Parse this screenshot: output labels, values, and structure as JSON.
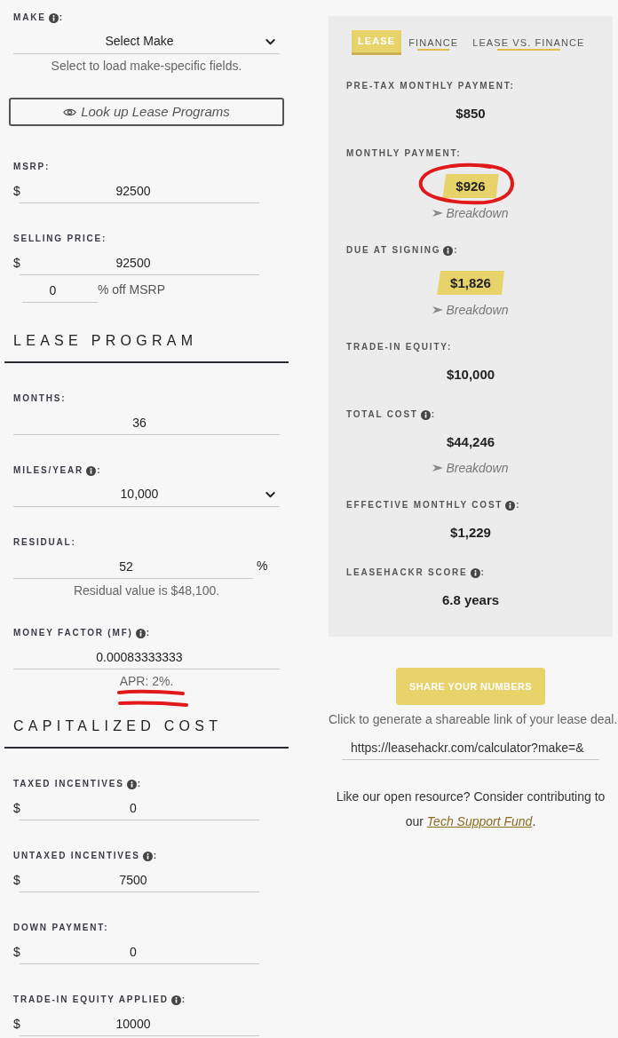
{
  "sections": [
    {
      "fields": [
        {
          "kind": "select",
          "label": "MAKE",
          "info": true,
          "suffix": ":",
          "value": "Select Make",
          "note": {
            "text": "Select to load make-specific fields.",
            "underlined": false
          }
        },
        {
          "kind": "button",
          "label": "Look up Lease Programs"
        },
        {
          "kind": "currency",
          "label": "MSRP:",
          "info": false,
          "currency": "$",
          "value": "92500"
        },
        {
          "kind": "currency",
          "label": "SELLING PRICE:",
          "info": false,
          "currency": "$",
          "value": "92500",
          "discount": {
            "value": "0",
            "label": "% off MSRP"
          }
        }
      ]
    },
    {
      "heading": "LEASE PROGRAM",
      "fields": [
        {
          "kind": "number",
          "label": "MONTHS:",
          "info": false,
          "value": "36"
        },
        {
          "kind": "select",
          "label": "MILES/YEAR",
          "info": true,
          "suffix": ":",
          "value": "10,000"
        },
        {
          "kind": "percent",
          "label": "RESIDUAL:",
          "info": false,
          "value": "52",
          "unit": "%",
          "note": {
            "text": "Residual value is $48,100.",
            "underlined": false
          }
        },
        {
          "kind": "number",
          "label": "MONEY FACTOR (MF)",
          "info": true,
          "suffix": ":",
          "value": "0.00083333333",
          "note": {
            "text": "APR: 2%.",
            "underlined": true
          }
        }
      ]
    },
    {
      "heading": "CAPITALIZED COST",
      "fields": [
        {
          "kind": "currency",
          "label": "TAXED INCENTIVES",
          "info": true,
          "suffix": ":",
          "currency": "$",
          "value": "0"
        },
        {
          "kind": "currency",
          "label": "UNTAXED INCENTIVES",
          "info": true,
          "suffix": ":",
          "currency": "$",
          "value": "7500"
        },
        {
          "kind": "currency",
          "label": "DOWN PAYMENT:",
          "info": false,
          "currency": "$",
          "value": "0"
        },
        {
          "kind": "currency",
          "label": "TRADE-IN EQUITY APPLIED",
          "info": true,
          "suffix": ":",
          "currency": "$",
          "value": "10000"
        }
      ]
    }
  ],
  "tabs": [
    {
      "label": "LEASE",
      "selected": true
    },
    {
      "label": "FINANCE",
      "selected": false
    },
    {
      "label": "LEASE VS. FINANCE",
      "selected": false
    }
  ],
  "results": [
    {
      "label": "PRE-TAX MONTHLY PAYMENT:",
      "info": false,
      "kind": "plain",
      "value": "$850",
      "circled": false
    },
    {
      "label": "MONTHLY PAYMENT:",
      "info": false,
      "kind": "tag",
      "value": "$926",
      "breakdown": "Breakdown",
      "circled": true
    },
    {
      "label": "DUE AT SIGNING",
      "info": true,
      "suffix": ":",
      "kind": "tag",
      "value": "$1,826",
      "breakdown": "Breakdown",
      "circled": false
    },
    {
      "label": "TRADE-IN EQUITY:",
      "info": false,
      "kind": "plain",
      "value": "$10,000",
      "circled": false
    },
    {
      "label": "TOTAL COST",
      "info": true,
      "suffix": ":",
      "kind": "plain",
      "value": "$44,246",
      "breakdown": "Breakdown",
      "circled": false
    },
    {
      "label": "EFFECTIVE MONTHLY COST",
      "info": true,
      "suffix": ":",
      "kind": "plain",
      "value": "$1,229",
      "circled": false
    },
    {
      "label": "LEASEHACKR SCORE",
      "info": true,
      "suffix": ":",
      "kind": "plain",
      "value": "6.8 years",
      "circled": false
    }
  ],
  "share": {
    "button": "SHARE YOUR NUMBERS",
    "hint": "Click to generate a shareable link of your lease deal.",
    "url": "https://leasehackr.com/calculator?make=&"
  },
  "support": {
    "text": "Like our open resource? Consider contributing to our",
    "link": "Tech Support Fund",
    "end": "."
  }
}
